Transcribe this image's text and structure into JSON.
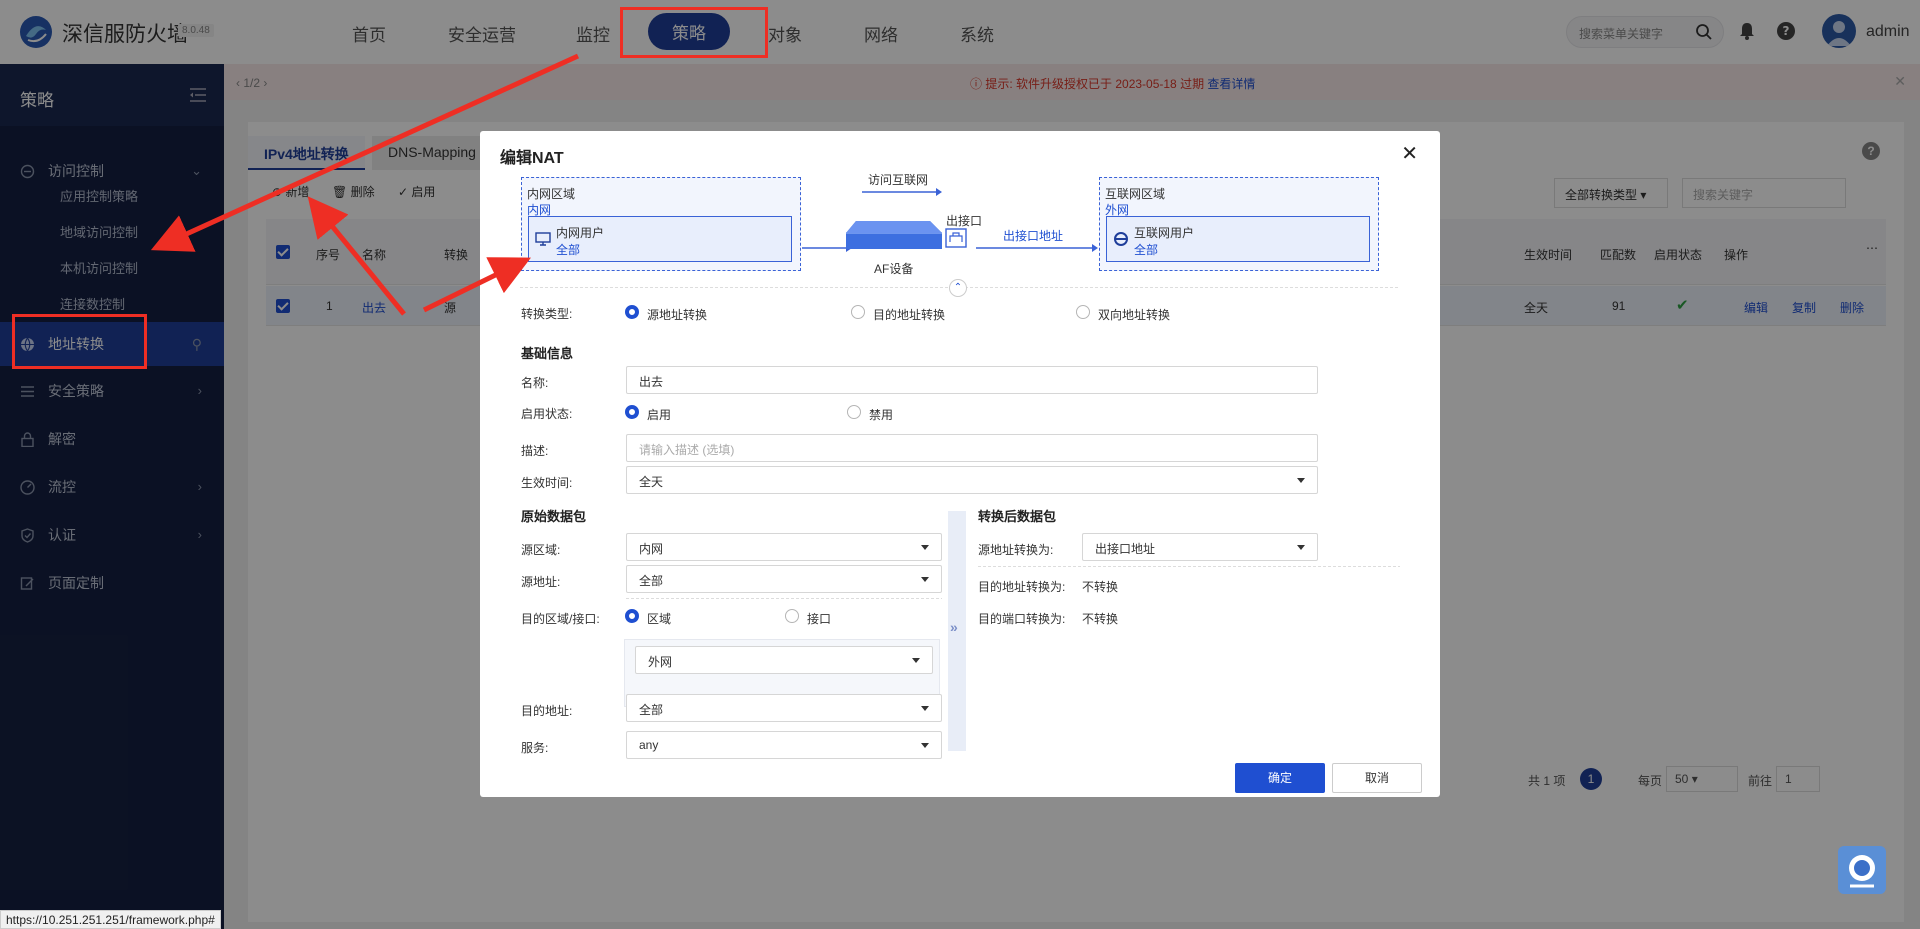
{
  "app": {
    "brand": "深信服防火墙",
    "version": "8.0.48"
  },
  "nav": {
    "items": [
      "首页",
      "安全运营",
      "监控",
      "策略",
      "对象",
      "网络",
      "系统"
    ],
    "active": "策略"
  },
  "top": {
    "search_placeholder": "搜索菜单关键字",
    "user": "admin"
  },
  "sidebar": {
    "title": "策略",
    "items": [
      {
        "label": "访问控制",
        "icon": "shield-link-icon"
      },
      {
        "label": "地址转换",
        "icon": "globe-icon"
      },
      {
        "label": "安全策略",
        "icon": "list-icon"
      },
      {
        "label": "解密",
        "icon": "lock-icon"
      },
      {
        "label": "流控",
        "icon": "gauge-icon"
      },
      {
        "label": "认证",
        "icon": "shield-check-icon"
      },
      {
        "label": "页面定制",
        "icon": "edit-icon"
      }
    ],
    "subitems": [
      "应用控制策略",
      "地域访问控制",
      "本机访问控制",
      "连接数控制"
    ]
  },
  "breadcrumb": {
    "pages": "1/2"
  },
  "notice": {
    "text": "提示: 软件升级授权已于 2023-05-18 过期",
    "link": "查看详情"
  },
  "tabs": [
    "IPv4地址转换",
    "DNS-Mapping"
  ],
  "toolbar": {
    "add": "新增",
    "delete": "删除",
    "enable": "启用",
    "type_filter": "全部转换类型",
    "search_placeholder": "搜索关键字"
  },
  "table": {
    "headers": [
      "序号",
      "名称",
      "转换",
      "生效时间",
      "匹配数",
      "启用状态",
      "操作"
    ],
    "row": {
      "index": "1",
      "name": "出去",
      "type": "源",
      "time": "全天",
      "matches": "91",
      "actions": [
        "编辑",
        "复制",
        "删除"
      ]
    }
  },
  "pager": {
    "total": "共 1 项",
    "page": "1",
    "per_page_label": "每页",
    "per_page": "50",
    "goto_label": "前往",
    "goto": "1"
  },
  "status_url": "https://10.251.251.251/framework.php#",
  "modal": {
    "title": "编辑NAT",
    "diagram": {
      "in_zone_label": "内网区域",
      "in_zone": "内网",
      "in_user_label": "内网用户",
      "in_user": "全部",
      "visit": "访问互联网",
      "device": "AF设备",
      "out_port": "出接口",
      "out_addr": "出接口地址",
      "ext_zone_label": "互联网区域",
      "ext_zone": "外网",
      "ext_user_label": "互联网用户",
      "ext_user": "全部"
    },
    "conv_type": {
      "label": "转换类型:",
      "options": [
        "源地址转换",
        "目的地址转换",
        "双向地址转换"
      ],
      "selected": 0
    },
    "basic": {
      "title": "基础信息",
      "name_label": "名称:",
      "name": "出去",
      "status_label": "启用状态:",
      "status_options": [
        "启用",
        "禁用"
      ],
      "desc_label": "描述:",
      "desc_placeholder": "请输入描述 (选填)",
      "time_label": "生效时间:",
      "time": "全天"
    },
    "orig": {
      "title": "原始数据包",
      "src_zone_label": "源区域:",
      "src_zone": "内网",
      "src_addr_label": "源地址:",
      "src_addr": "全部",
      "dst_label": "目的区域/接口:",
      "dst_options": [
        "区域",
        "接口"
      ],
      "dst_zone": "外网",
      "dst_addr_label": "目的地址:",
      "dst_addr": "全部",
      "service_label": "服务:",
      "service": "any"
    },
    "after": {
      "title": "转换后数据包",
      "src_conv_label": "源地址转换为:",
      "src_conv": "出接口地址",
      "dst_conv_label": "目的地址转换为:",
      "dst_conv": "不转换",
      "port_conv_label": "目的端口转换为:",
      "port_conv": "不转换"
    },
    "ok": "确定",
    "cancel": "取消"
  },
  "colors": {
    "accent": "#1f4fd1",
    "nav_active": "#1f3e9a",
    "sidebar": "#152042",
    "annotation": "#ee2e24"
  }
}
